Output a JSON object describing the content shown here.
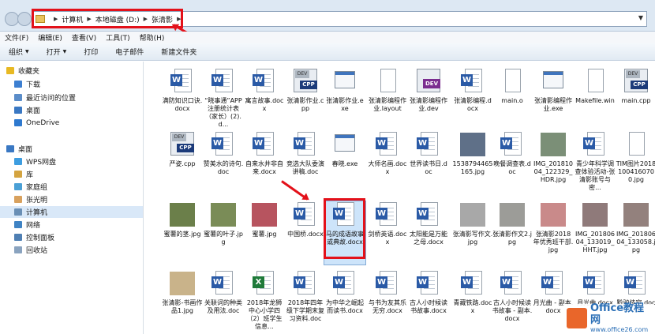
{
  "address": {
    "crumbs": [
      "计算机",
      "本地磁盘 (D:)",
      "张清影"
    ]
  },
  "menu": [
    "文件(F)",
    "编辑(E)",
    "查看(V)",
    "工具(T)",
    "帮助(H)"
  ],
  "toolbar": [
    {
      "label": "组织",
      "caret": true
    },
    {
      "label": "打开",
      "caret": true
    },
    {
      "label": "打印",
      "caret": false
    },
    {
      "label": "电子邮件",
      "caret": false
    },
    {
      "label": "新建文件夹",
      "caret": false
    }
  ],
  "sidebar": [
    {
      "label": "收藏夹",
      "icon": "star-icon"
    },
    {
      "label": "下载",
      "icon": "download-icon"
    },
    {
      "label": "最近访问的位置",
      "icon": "recent-places-icon"
    },
    {
      "label": "桌面",
      "icon": "desktop-icon"
    },
    {
      "label": "OneDrive",
      "icon": "onedrive-icon"
    },
    {
      "label": "桌面",
      "icon": "desktop-icon"
    },
    {
      "label": "WPS网盘",
      "icon": "cloud-icon"
    },
    {
      "label": "库",
      "icon": "library-icon"
    },
    {
      "label": "家庭组",
      "icon": "homegroup-icon"
    },
    {
      "label": "张光明",
      "icon": "user-icon"
    },
    {
      "label": "计算机",
      "icon": "computer-icon"
    },
    {
      "label": "网络",
      "icon": "network-icon"
    },
    {
      "label": "控制面板",
      "icon": "control-panel-icon"
    },
    {
      "label": "回收站",
      "icon": "recycle-bin-icon"
    }
  ],
  "files": [
    {
      "name": "满防知识口诀.docx",
      "type": "word"
    },
    {
      "name": "“晓事通”APP注册统计表（家长）(2).d...",
      "type": "word"
    },
    {
      "name": "寓言故事.docx",
      "type": "word"
    },
    {
      "name": "张清影作业.cpp",
      "type": "cpp"
    },
    {
      "name": "张清影作业.exe",
      "type": "exe"
    },
    {
      "name": "张清影编程作业.layout",
      "type": "plain"
    },
    {
      "name": "张清影编程作业.dev",
      "type": "dev"
    },
    {
      "name": "张清影编程.docx",
      "type": "word"
    },
    {
      "name": "main.o",
      "type": "plain"
    },
    {
      "name": "张清影编程作业.exe",
      "type": "exe"
    },
    {
      "name": "Makefile.win",
      "type": "plain"
    },
    {
      "name": "main.cpp",
      "type": "cpp"
    },
    {
      "name": "严姿.cpp",
      "type": "cpp"
    },
    {
      "name": "赞美水的诗句.doc",
      "type": "word"
    },
    {
      "name": "自来水井非自来.docx",
      "type": "word"
    },
    {
      "name": "竞选大队委演讲稿.doc",
      "type": "word"
    },
    {
      "name": "春晓.exe",
      "type": "exe"
    },
    {
      "name": "大师名画.docx",
      "type": "word"
    },
    {
      "name": "世界读书日.doc",
      "type": "word"
    },
    {
      "name": "1538794465165.jpg",
      "type": "photo",
      "color": "#5f7088"
    },
    {
      "name": "晚餐调查表.doc",
      "type": "word"
    },
    {
      "name": "IMG_20181004_122329_HDR.jpg",
      "type": "photo",
      "color": "#7b8f77"
    },
    {
      "name": "青少年科学调查体验活动-张清影账号与密...",
      "type": "word"
    },
    {
      "name": "TIM图片20181004160700.jpg",
      "type": "plain"
    },
    {
      "name": "蜜薯的茎.jpg",
      "type": "photo",
      "color": "#6b7f4a"
    },
    {
      "name": "蜜薯的叶子.jpg",
      "type": "photo",
      "color": "#7a8c57"
    },
    {
      "name": "蜜薯.jpg",
      "type": "photo",
      "color": "#b7545f"
    },
    {
      "name": "中国桥.docx",
      "type": "word"
    },
    {
      "name": "马的成语故事或典故.docx",
      "type": "word",
      "selected": true
    },
    {
      "name": "剑桥英语.docx",
      "type": "word"
    },
    {
      "name": "太阳能是万能之母.docx",
      "type": "word"
    },
    {
      "name": "张清影写作文.jpg",
      "type": "photo",
      "color": "#a8a8a8"
    },
    {
      "name": "张清影作文2.jpg",
      "type": "photo",
      "color": "#9c9c98"
    },
    {
      "name": "张清影2018年优秀班干部.jpg",
      "type": "photo",
      "color": "#c98a8a"
    },
    {
      "name": "IMG_20180604_133019_HHT.jpg",
      "type": "photo",
      "color": "#8f7a7a"
    },
    {
      "name": "IMG_20180604_133058.jpg",
      "type": "photo",
      "color": "#93817d"
    },
    {
      "name": "张清影-书画作品1.jpg",
      "type": "photo",
      "color": "#c9b38a"
    },
    {
      "name": "关联词的种类及用法.doc",
      "type": "word"
    },
    {
      "name": "2018年龙狮中心小学四（2）班学生信息...",
      "type": "excel"
    },
    {
      "name": "2018年四年级下学期末复习资料.doc",
      "type": "word"
    },
    {
      "name": "为中华之崛起而读书.docx",
      "type": "word"
    },
    {
      "name": "与书为友其乐无穷.docx",
      "type": "word"
    },
    {
      "name": "古人小时候读书故事.docx",
      "type": "word"
    },
    {
      "name": "青藏铁路.docx",
      "type": "word"
    },
    {
      "name": "古人小时候读书故事 - 副本.docx",
      "type": "word"
    },
    {
      "name": "月光曲 - 副本.docx",
      "type": "word"
    },
    {
      "name": "月光曲.docx",
      "type": "word"
    },
    {
      "name": "黔驴技穷.docx",
      "type": "word"
    }
  ],
  "watermark": {
    "line1": "Office教程网",
    "line2": "www.office26.com"
  },
  "colors": {
    "highlight": "#e3111a",
    "selection": "#cde4fa",
    "word": "#2a5aa6"
  }
}
